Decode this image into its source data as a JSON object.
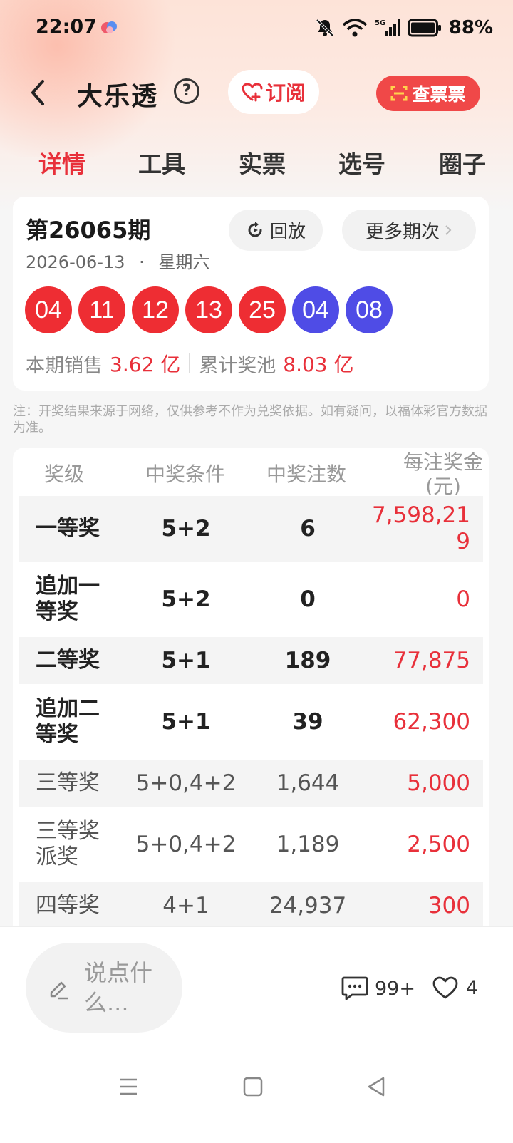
{
  "status_bar": {
    "time": "22:07",
    "battery": "88%",
    "network": "5G"
  },
  "header": {
    "title": "大乐透",
    "help_label": "?",
    "subscribe_label": "订阅",
    "check_ticket_label": "查票票"
  },
  "tabs": [
    {
      "label": "详情",
      "active": true
    },
    {
      "label": "工具",
      "active": false
    },
    {
      "label": "实票",
      "active": false
    },
    {
      "label": "选号",
      "active": false
    },
    {
      "label": "圈子",
      "active": false
    }
  ],
  "draw": {
    "issue": "第26065期",
    "date": "2026-06-13",
    "weekday": "星期六",
    "date_separator": "·",
    "replay_label": "回放",
    "more_label": "更多期次",
    "red_balls": [
      "04",
      "11",
      "12",
      "13",
      "25"
    ],
    "blue_balls": [
      "04",
      "08"
    ],
    "sales_label": "本期销售",
    "sales_value": "3.62 亿",
    "pool_label": "累计奖池",
    "pool_value": "8.03 亿"
  },
  "disclaimer": "注：开奖结果来源于网络，仅供参考不作为兑奖依据。如有疑问，以福体彩官方数据为准。",
  "prize_table": {
    "headers": [
      "奖级",
      "中奖条件",
      "中奖注数",
      "每注奖金(元)"
    ],
    "rows": [
      {
        "level": "一等奖",
        "condition": "5+2",
        "count": "6",
        "amount": "7,598,219"
      },
      {
        "level": "追加一等奖",
        "condition": "5+2",
        "count": "0",
        "amount": "0"
      },
      {
        "level": "二等奖",
        "condition": "5+1",
        "count": "189",
        "amount": "77,875"
      },
      {
        "level": "追加二等奖",
        "condition": "5+1",
        "count": "39",
        "amount": "62,300"
      },
      {
        "level": "三等奖",
        "condition": "5+0,4+2",
        "count": "1,644",
        "amount": "5,000"
      },
      {
        "level": "三等奖派奖",
        "condition": "5+0,4+2",
        "count": "1,189",
        "amount": "2,500"
      },
      {
        "level": "四等奖",
        "condition": "4+1",
        "count": "24,937",
        "amount": "300"
      }
    ]
  },
  "bottom_bar": {
    "comment_placeholder": "说点什么...",
    "comment_count": "99+",
    "like_count": "4"
  },
  "colors": {
    "accent_red": "#e8303a",
    "ball_red": "#ee2d33",
    "ball_blue": "#4f4ce6"
  }
}
